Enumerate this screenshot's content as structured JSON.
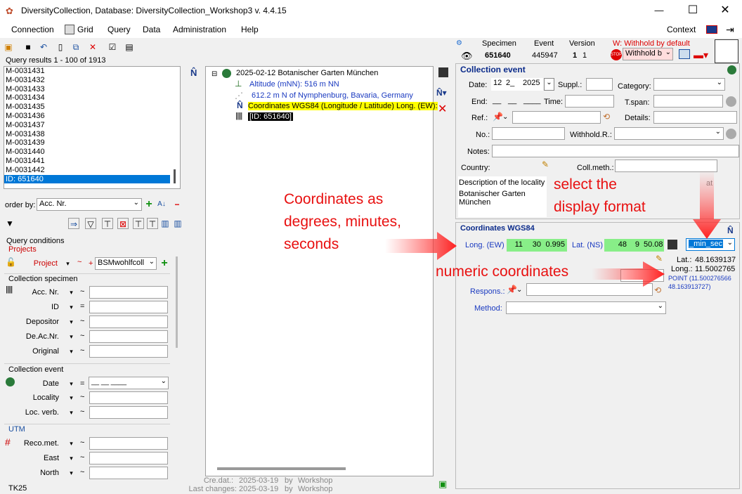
{
  "window": {
    "title": "DiversityCollection,  Database: DiversityCollection_Workshop3    v. 4.4.15",
    "minimize": "—",
    "maximize": "☐",
    "close": "✕"
  },
  "menu": {
    "items": [
      "Connection",
      "Grid",
      "Query",
      "Data",
      "Administration",
      "Help"
    ],
    "context": "Context"
  },
  "query_results": {
    "header": "Query results   1 - 100 of 1913",
    "items": [
      "M-0031431",
      "M-0031432",
      "M-0031433",
      "M-0031434",
      "M-0031435",
      "M-0031436",
      "M-0031437",
      "M-0031438",
      "M-0031439",
      "M-0031440",
      "M-0031441",
      "M-0031442"
    ],
    "selected": "ID: 651640"
  },
  "order_by": {
    "label": "order by:",
    "value": "Acc. Nr."
  },
  "query_conditions": {
    "title": "Query conditions",
    "projects_title": "Projects",
    "project_label": "Project",
    "project_value": "BSMwohlfcoll",
    "specimen_title": "Collection specimen",
    "specimen_fields": [
      {
        "label": "Acc. Nr.",
        "op": "~"
      },
      {
        "label": "ID",
        "op": "="
      },
      {
        "label": "Depositor",
        "op": "~"
      },
      {
        "label": "De.Ac.Nr.",
        "op": "~"
      },
      {
        "label": "Original",
        "op": "~"
      }
    ],
    "event_title": "Collection event",
    "date_label": "Date",
    "date_op": "=",
    "event_fields": [
      {
        "label": "Locality",
        "op": "~"
      },
      {
        "label": "Loc. verb.",
        "op": "~"
      }
    ],
    "utm_title": "UTM",
    "utm_fields": [
      {
        "label": "Reco.met.",
        "op": "~"
      },
      {
        "label": "East",
        "op": "~"
      },
      {
        "label": "North",
        "op": "~"
      }
    ],
    "tk25_title": "TK25",
    "tilde": "~",
    "plus": "+"
  },
  "tree": {
    "root": "2025-02-12 Botanischer Garten München",
    "altitude": "Altitude (mNN): 516 m NN",
    "place": "612.2 m N of  Nymphenburg, Bavaria, Germany",
    "coordinates": "Coordinates WGS84 (Longitude / Latitude) Long. (EW):",
    "id": "[ID: 651640]"
  },
  "footer": {
    "created_label": "Cre.dat.:",
    "created_date": "2025-03-19",
    "created_by": "by",
    "created_user": "Workshop",
    "changed_label": "Last changes:",
    "changed_date": "2025-03-19",
    "changed_by": "by",
    "changed_user": "Workshop"
  },
  "header_info": {
    "specimen_label": "Specimen",
    "specimen_value": "651640",
    "event_label": "Event",
    "event_value": "445947",
    "version_label": "Version",
    "version_value": "1",
    "version_extra": "1",
    "withhold_label": "W: Withhold by default",
    "withhold_value": "Withhold b",
    "stop": "STOP"
  },
  "collection_event": {
    "title": "Collection event",
    "date_label": "Date:",
    "day": "12",
    "month": "2_",
    "year": "2025",
    "suppl_label": "Suppl.:",
    "category_label": "Category:",
    "end_label": "End:",
    "end_day": "__",
    "end_month": "__",
    "end_year": "____",
    "time_label": "Time:",
    "tspan_label": "T.span:",
    "ref_label": "Ref.:",
    "details_label": "Details:",
    "no_label": "No.:",
    "withhold_label": "Withhold.R.:",
    "notes_label": "Notes:",
    "country_label": "Country:",
    "collmeth_label": "Coll.meth.:",
    "desc_label": "Description of the locality",
    "desc_value": "Botanischer Garten\nMünchen",
    "at_label": "at"
  },
  "coordinates": {
    "title": "Coordinates WGS84",
    "long_label": "Long. (EW)",
    "long_deg": "11",
    "long_min": "30",
    "long_sec": "0.995",
    "lat_label": "Lat. (NS)",
    "lat_deg": "48",
    "lat_min": "9",
    "lat_sec": "50.08",
    "format_value": "_min_sec",
    "lat_num_label": "Lat.:",
    "lat_num_value": "48.1639137",
    "long_num_label": "Long.:",
    "long_num_value": "11.5002765",
    "point": "POINT (11.500276566",
    "point2": "48.163913727)",
    "respons_label": "Respons.:",
    "method_label": "Method:"
  },
  "annotations": {
    "dms": "Coordinates as\ndegrees, minutes,\nseconds",
    "format": "select the\ndisplay format",
    "numeric": "numeric coordinates"
  },
  "colors": {
    "accent": "#0078d7",
    "annotation": "#e81010",
    "green": "#88ee88",
    "yellow_highlight": "#ffff00"
  }
}
